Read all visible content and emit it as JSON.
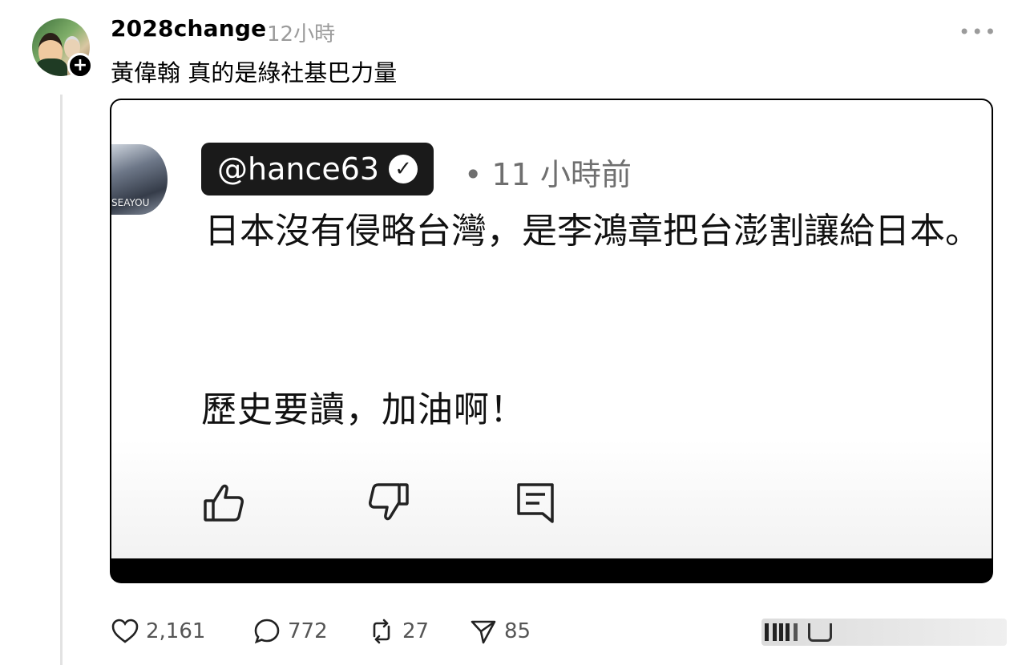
{
  "post": {
    "username": "2028change",
    "time": "12小時",
    "caption": "黃偉翰 真的是綠社基巴力量",
    "more_icon": "more-horizontal-icon",
    "follow_icon": "plus-icon"
  },
  "quoted": {
    "handle": "@hance63",
    "verified_icon": "checkmark-icon",
    "time": "• 11 小時前",
    "text_line1": "日本沒有侵略台灣，是李鴻章把台澎割讓給日本。",
    "text_line2": "歷史要讀，加油啊！",
    "actions": [
      "thumbs-up-icon",
      "thumbs-down-icon",
      "comment-icon"
    ]
  },
  "stats": {
    "likes": "2,161",
    "comments": "772",
    "reposts": "27",
    "shares": "85"
  },
  "colors": {
    "muted": "#9b9b9b",
    "badge": "#000000"
  }
}
